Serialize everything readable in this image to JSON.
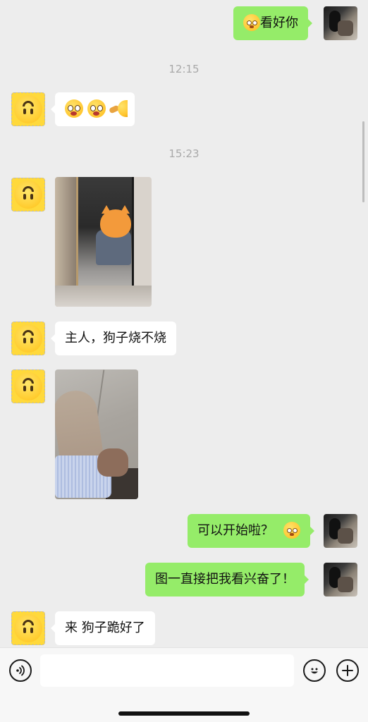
{
  "messages": {
    "m1": {
      "sender": "me",
      "text": "看好你",
      "emoji": "flushed-emoji"
    },
    "t1": "12:15",
    "m2": {
      "sender": "other",
      "emojis": [
        "big-eyes-emoji",
        "big-eyes-emoji",
        "hand-emoji"
      ]
    },
    "t2": "15:23",
    "m3": {
      "sender": "other",
      "type": "image",
      "image": "mirror-selfie-photo"
    },
    "m4": {
      "sender": "other",
      "text": "主人，狗子烧不烧"
    },
    "m5": {
      "sender": "other",
      "type": "image",
      "image": "legs-closeup-photo"
    },
    "m6": {
      "sender": "me",
      "text": "可以开始啦？",
      "emoji": "flushed-emoji"
    },
    "m7": {
      "sender": "me",
      "text": "图一直接把我看兴奋了！"
    },
    "m8": {
      "sender": "other",
      "text": "来 狗子跪好了"
    }
  },
  "input": {
    "value": "",
    "placeholder": ""
  },
  "icons": {
    "voice": "voice-icon",
    "emoji": "emoji-icon",
    "plus": "plus-icon"
  },
  "colors": {
    "background": "#ededed",
    "my_bubble": "#95ec69",
    "their_bubble": "#ffffff",
    "timestamp": "#a9a9a9"
  }
}
